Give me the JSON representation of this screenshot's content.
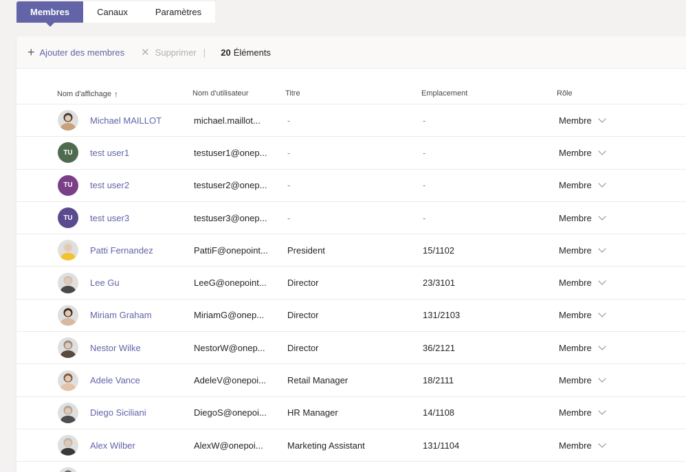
{
  "tabs": [
    {
      "label": "Membres",
      "active": true
    },
    {
      "label": "Canaux",
      "active": false
    },
    {
      "label": "Paramètres",
      "active": false
    }
  ],
  "toolbar": {
    "add_label": "Ajouter des membres",
    "delete_label": "Supprimer",
    "count_number": "20",
    "count_label": "Éléments"
  },
  "table": {
    "headers": {
      "display_name": "Nom d'affichage",
      "username": "Nom d'utilisateur",
      "title": "Titre",
      "location": "Emplacement",
      "role": "Rôle"
    },
    "sort_icon": "arrow-up-icon",
    "rows": [
      {
        "name": "Michael MAILLOT",
        "username": "michael.maillot...",
        "title": "-",
        "location": "-",
        "role": "Membre",
        "avatar": {
          "type": "photo",
          "icon": "photo-avatar-icon",
          "colors": [
            "#3b3a39",
            "#c8a27a"
          ]
        }
      },
      {
        "name": "test user1",
        "username": "testuser1@onep...",
        "title": "-",
        "location": "-",
        "role": "Membre",
        "avatar": {
          "type": "initials",
          "initials": "TU",
          "color": "#4f6b4f"
        }
      },
      {
        "name": "test user2",
        "username": "testuser2@onep...",
        "title": "-",
        "location": "-",
        "role": "Membre",
        "avatar": {
          "type": "initials",
          "initials": "TU",
          "color": "#7b3f87"
        }
      },
      {
        "name": "test user3",
        "username": "testuser3@onep...",
        "title": "-",
        "location": "-",
        "role": "Membre",
        "avatar": {
          "type": "initials",
          "initials": "TU",
          "color": "#5c4a8f"
        }
      },
      {
        "name": "Patti Fernandez",
        "username": "PattiF@onepoint...",
        "title": "President",
        "location": "15/1102",
        "role": "Membre",
        "avatar": {
          "type": "photo",
          "icon": "photo-avatar-icon",
          "colors": [
            "#d9d4c8",
            "#f2c230"
          ]
        }
      },
      {
        "name": "Lee Gu",
        "username": "LeeG@onepoint...",
        "title": "Director",
        "location": "23/3101",
        "role": "Membre",
        "avatar": {
          "type": "photo",
          "icon": "photo-avatar-icon",
          "colors": [
            "#c7c4be",
            "#4a4a4a"
          ]
        }
      },
      {
        "name": "Miriam Graham",
        "username": "MiriamG@onep...",
        "title": "Director",
        "location": "131/2103",
        "role": "Membre",
        "avatar": {
          "type": "photo",
          "icon": "photo-avatar-icon",
          "colors": [
            "#2e2a28",
            "#d8b9a0"
          ]
        }
      },
      {
        "name": "Nestor Wilke",
        "username": "NestorW@onep...",
        "title": "Director",
        "location": "36/2121",
        "role": "Membre",
        "avatar": {
          "type": "photo",
          "icon": "photo-avatar-icon",
          "colors": [
            "#8d8d8d",
            "#5a4a3e"
          ]
        }
      },
      {
        "name": "Adele Vance",
        "username": "AdeleV@onepoi...",
        "title": "Retail Manager",
        "location": "18/2111",
        "role": "Membre",
        "avatar": {
          "type": "photo",
          "icon": "photo-avatar-icon",
          "colors": [
            "#7a5a44",
            "#e2c2a8"
          ]
        }
      },
      {
        "name": "Diego Siciliani",
        "username": "DiegoS@onepoi...",
        "title": "HR Manager",
        "location": "14/1108",
        "role": "Membre",
        "avatar": {
          "type": "photo",
          "icon": "photo-avatar-icon",
          "colors": [
            "#a7a7a7",
            "#4e4e52"
          ]
        }
      },
      {
        "name": "Alex Wilber",
        "username": "AlexW@onepoi...",
        "title": "Marketing Assistant",
        "location": "131/1104",
        "role": "Membre",
        "avatar": {
          "type": "photo",
          "icon": "photo-avatar-icon",
          "colors": [
            "#b8b8b8",
            "#3a3a3a"
          ]
        }
      },
      {
        "name": "",
        "username": "",
        "title": "",
        "location": "",
        "role": "",
        "avatar": {
          "type": "photo",
          "icon": "photo-avatar-icon",
          "colors": [
            "#6e6e6e",
            "#2a2a2a"
          ]
        }
      }
    ]
  },
  "colors": {
    "accent": "#6264a7",
    "background": "#f3f2f1",
    "muted": "#8a8886"
  }
}
